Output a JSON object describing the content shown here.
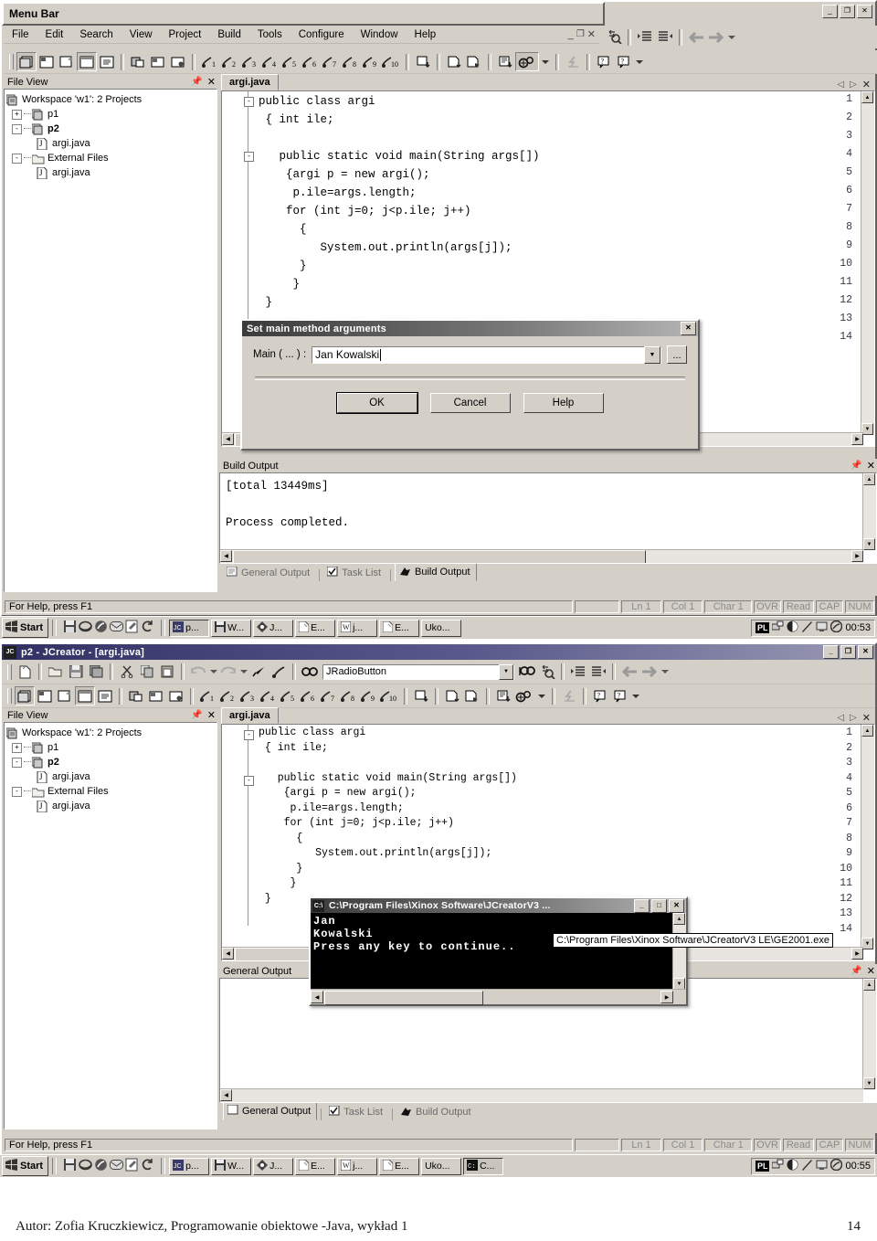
{
  "window1": {
    "menubar_label": "Menu Bar",
    "menu_items": [
      "File",
      "Edit",
      "Search",
      "View",
      "Project",
      "Build",
      "Tools",
      "Configure",
      "Window",
      "Help"
    ],
    "window_buttons": [
      "minimize",
      "restore",
      "close"
    ],
    "mdi_buttons": [
      "minimize",
      "restore",
      "close"
    ],
    "fileview": {
      "title": "File View",
      "pin": "pin-icon",
      "close": "close-icon",
      "root": "Workspace 'w1': 2 Projects",
      "nodes": [
        {
          "expander": "+",
          "label": "p1",
          "icon": "project-icon",
          "indent": 0,
          "bold": false
        },
        {
          "expander": "-",
          "label": "p2",
          "icon": "project-icon",
          "indent": 0,
          "bold": true
        },
        {
          "expander": "",
          "label": "argi.java",
          "icon": "java-file-icon",
          "indent": 1,
          "bold": false
        },
        {
          "expander": "-",
          "label": "External Files",
          "icon": "folder-icon",
          "indent": 0,
          "bold": false
        },
        {
          "expander": "",
          "label": "argi.java",
          "icon": "java-file-icon",
          "indent": 1,
          "bold": false
        }
      ]
    },
    "editor": {
      "tab": "argi.java",
      "lines": [
        {
          "n": "1",
          "fold": "-",
          "text": "public class argi"
        },
        {
          "n": "2",
          "fold": "",
          "text": " { int ile;"
        },
        {
          "n": "3",
          "fold": "",
          "text": ""
        },
        {
          "n": "4",
          "fold": "-",
          "text": "   public static void main(String args[])"
        },
        {
          "n": "5",
          "fold": "",
          "text": "    {argi p = new argi();"
        },
        {
          "n": "6",
          "fold": "",
          "text": "     p.ile=args.length;"
        },
        {
          "n": "7",
          "fold": "",
          "text": "    for (int j=0; j<p.ile; j++)"
        },
        {
          "n": "8",
          "fold": "",
          "text": "      {"
        },
        {
          "n": "9",
          "fold": "",
          "text": "         System.out.println(args[j]);"
        },
        {
          "n": "10",
          "fold": "",
          "text": "      }"
        },
        {
          "n": "11",
          "fold": "",
          "text": "     }"
        },
        {
          "n": "12",
          "fold": "",
          "text": " }"
        },
        {
          "n": "13",
          "fold": "",
          "text": ""
        },
        {
          "n": "14",
          "fold": "",
          "text": ""
        }
      ]
    },
    "build_output": {
      "title": "Build Output",
      "text": "[total 13449ms]\n\nProcess completed."
    },
    "output_tabs": [
      {
        "label": "General Output",
        "icon": "document-icon",
        "selected": false
      },
      {
        "label": "Task List",
        "icon": "checkbox-icon",
        "selected": false
      },
      {
        "label": "Build Output",
        "icon": "runner-icon",
        "selected": true
      }
    ],
    "statusbar": {
      "help": "For Help, press F1",
      "ln": "Ln 1",
      "col": "Col 1",
      "char": "Char 1",
      "ovr": "OVR",
      "read": "Read",
      "cap": "CAP",
      "num": "NUM"
    },
    "taskbar": {
      "start": "Start",
      "quick_launch": [
        "save-icon",
        "ie-icon",
        "netscape-icon",
        "mail-icon",
        "edit-icon",
        "refresh-icon"
      ],
      "buttons": [
        {
          "label": "p...",
          "icon": "jcreator-icon",
          "active": true
        },
        {
          "label": "W...",
          "icon": "floppy-icon",
          "active": false
        },
        {
          "label": "J...",
          "icon": "acrobat-icon",
          "active": false
        },
        {
          "label": "E...",
          "icon": "page-icon",
          "active": false
        },
        {
          "label": "j...",
          "icon": "word-icon",
          "active": false
        },
        {
          "label": "E...",
          "icon": "page-icon",
          "active": false
        },
        {
          "label": "Uko...",
          "icon": "",
          "active": false
        }
      ],
      "tray_lang": "PL",
      "tray_icons": [
        "network-icon",
        "volume-icon",
        "pencil-icon",
        "display-icon",
        "antivirus-icon"
      ],
      "clock": "00:53"
    }
  },
  "dialog": {
    "title": "Set main method arguments",
    "close": "close-icon",
    "field_label": "Main ( ... ) :",
    "field_value": "Jan Kowalski",
    "dropdown": "chevron-down-icon",
    "browse": "...",
    "buttons": [
      {
        "label": "OK",
        "default": true
      },
      {
        "label": "Cancel",
        "default": false
      },
      {
        "label": "Help",
        "default": false
      }
    ]
  },
  "window2": {
    "title": "p2 - JCreator - [argi.java]",
    "app_icon": "jcreator-icon",
    "window_buttons": [
      "minimize",
      "restore",
      "close"
    ],
    "search_combo_value": "JRadioButton",
    "fileview": {
      "title": "File View",
      "root": "Workspace 'w1': 2 Projects",
      "nodes": [
        {
          "expander": "+",
          "label": "p1",
          "icon": "project-icon",
          "indent": 0,
          "bold": false
        },
        {
          "expander": "-",
          "label": "p2",
          "icon": "project-icon",
          "indent": 0,
          "bold": true
        },
        {
          "expander": "",
          "label": "argi.java",
          "icon": "java-file-icon",
          "indent": 1,
          "bold": false
        },
        {
          "expander": "-",
          "label": "External Files",
          "icon": "folder-icon",
          "indent": 0,
          "bold": false
        },
        {
          "expander": "",
          "label": "argi.java",
          "icon": "java-file-icon",
          "indent": 1,
          "bold": false
        }
      ]
    },
    "editor": {
      "tab": "argi.java",
      "lines": [
        {
          "n": "1",
          "fold": "-",
          "text": "public class argi"
        },
        {
          "n": "2",
          "fold": "",
          "text": " { int ile;"
        },
        {
          "n": "3",
          "fold": "",
          "text": ""
        },
        {
          "n": "4",
          "fold": "-",
          "text": "   public static void main(String args[])"
        },
        {
          "n": "5",
          "fold": "",
          "text": "    {argi p = new argi();"
        },
        {
          "n": "6",
          "fold": "",
          "text": "     p.ile=args.length;"
        },
        {
          "n": "7",
          "fold": "",
          "text": "    for (int j=0; j<p.ile; j++)"
        },
        {
          "n": "8",
          "fold": "",
          "text": "      {"
        },
        {
          "n": "9",
          "fold": "",
          "text": "         System.out.println(args[j]);"
        },
        {
          "n": "10",
          "fold": "",
          "text": "      }"
        },
        {
          "n": "11",
          "fold": "",
          "text": "     }"
        },
        {
          "n": "12",
          "fold": "",
          "text": " }"
        },
        {
          "n": "13",
          "fold": "",
          "text": ""
        },
        {
          "n": "14",
          "fold": "",
          "text": ""
        }
      ]
    },
    "general_output": {
      "title": "General Output",
      "text": ""
    },
    "output_tabs": [
      {
        "label": "General Output",
        "icon": "document-icon",
        "selected": true
      },
      {
        "label": "Task List",
        "icon": "checkbox-icon",
        "selected": false
      },
      {
        "label": "Build Output",
        "icon": "runner-icon",
        "selected": false
      }
    ],
    "statusbar": {
      "help": "For Help, press F1",
      "ln": "Ln 1",
      "col": "Col 1",
      "char": "Char 1",
      "ovr": "OVR",
      "read": "Read",
      "cap": "CAP",
      "num": "NUM"
    },
    "taskbar": {
      "start": "Start",
      "buttons": [
        {
          "label": "p...",
          "icon": "jcreator-icon",
          "active": false
        },
        {
          "label": "W...",
          "icon": "floppy-icon",
          "active": false
        },
        {
          "label": "J...",
          "icon": "acrobat-icon",
          "active": false
        },
        {
          "label": "E...",
          "icon": "page-icon",
          "active": false
        },
        {
          "label": "j...",
          "icon": "word-icon",
          "active": false
        },
        {
          "label": "E...",
          "icon": "page-icon",
          "active": false
        },
        {
          "label": "Uko...",
          "icon": "",
          "active": false
        },
        {
          "label": "C...",
          "icon": "console-icon",
          "active": true
        }
      ],
      "tray_lang": "PL",
      "clock": "00:55"
    }
  },
  "console": {
    "title": "C:\\Program Files\\Xinox Software\\JCreatorV3 ...",
    "icon": "console-icon",
    "buttons": [
      "minimize",
      "maximize",
      "close"
    ],
    "text": "Jan\nKowalski\nPress any key to continue..",
    "tooltip": "C:\\Program Files\\Xinox Software\\JCreatorV3 LE\\GE2001.exe"
  },
  "footer": {
    "author": "Autor:  Zofia Kruczkiewicz, Programowanie obiektowe -Java, wykład 1",
    "page": "14"
  },
  "colors": {
    "face": "#d4d0c8",
    "title_active": "#313163",
    "text": "#000000",
    "console_bg": "#000000"
  }
}
